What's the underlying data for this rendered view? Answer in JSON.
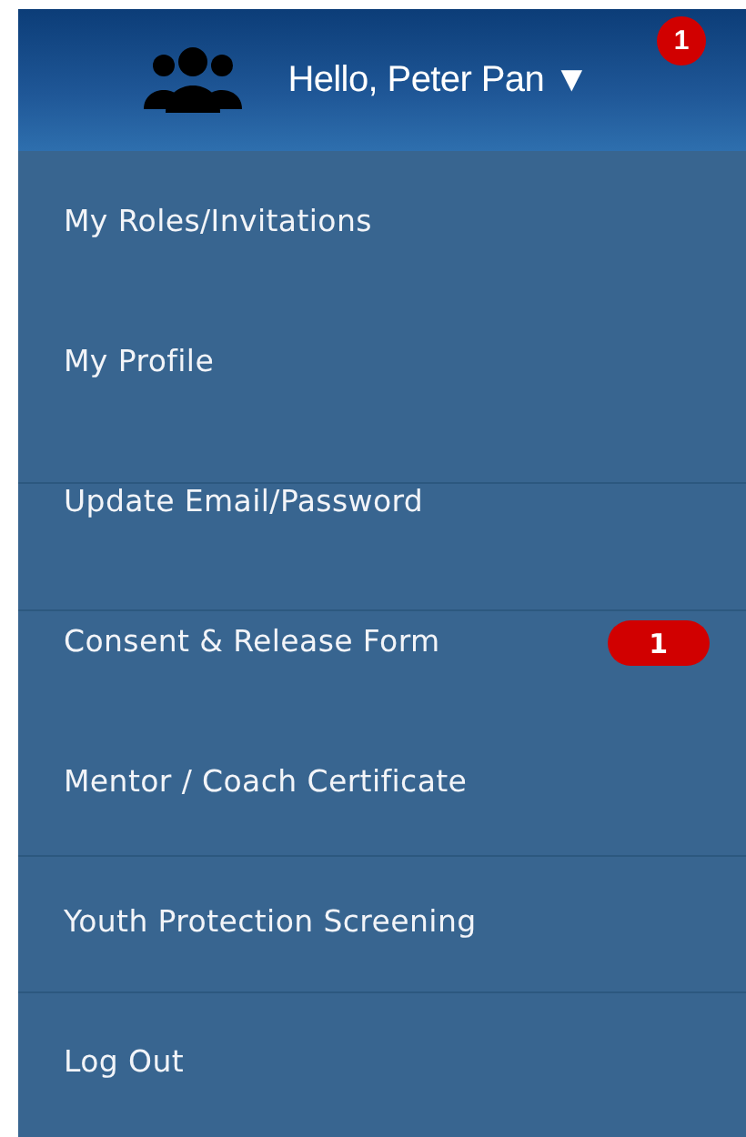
{
  "header": {
    "greeting": "Hello, Peter Pan",
    "caret": "▼",
    "badge": "1"
  },
  "menu": [
    {
      "label": "My Roles/Invitations"
    },
    {
      "label": "My Profile"
    },
    {
      "label": "Update Email/Password"
    },
    {
      "label": "Consent & Release Form",
      "badge": "1"
    },
    {
      "label": "Mentor / Coach Certificate"
    },
    {
      "label": "Youth Protection Screening"
    },
    {
      "label": "Log Out"
    }
  ]
}
